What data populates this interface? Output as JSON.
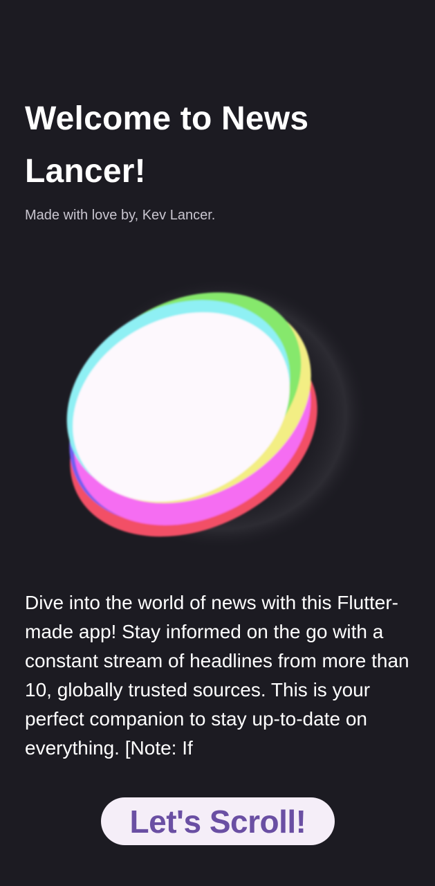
{
  "welcome": {
    "title": "Welcome to News Lancer!",
    "subtitle": "Made with love by, Kev Lancer."
  },
  "intro": {
    "description": "Dive into the world of news with this Flutter-made app! Stay informed on the go with a constant stream of headlines from more than 10, globally trusted sources. This is your perfect companion to stay up-to-date on everything. [Note: If"
  },
  "actions": {
    "scroll_label": "Let's Scroll!"
  },
  "colors": {
    "background": "#1c1b22",
    "button_background": "#f5eef8",
    "button_text": "#6a4fa3",
    "orb_red": "#f24f66",
    "orb_magenta": "#f56df2",
    "orb_yellow": "#f3ee84",
    "orb_green": "#86e86c",
    "orb_cyan": "#8ff0f4",
    "orb_blue": "#6f5ef0"
  },
  "illustration": {
    "icon": "gradient-orb-icon"
  }
}
